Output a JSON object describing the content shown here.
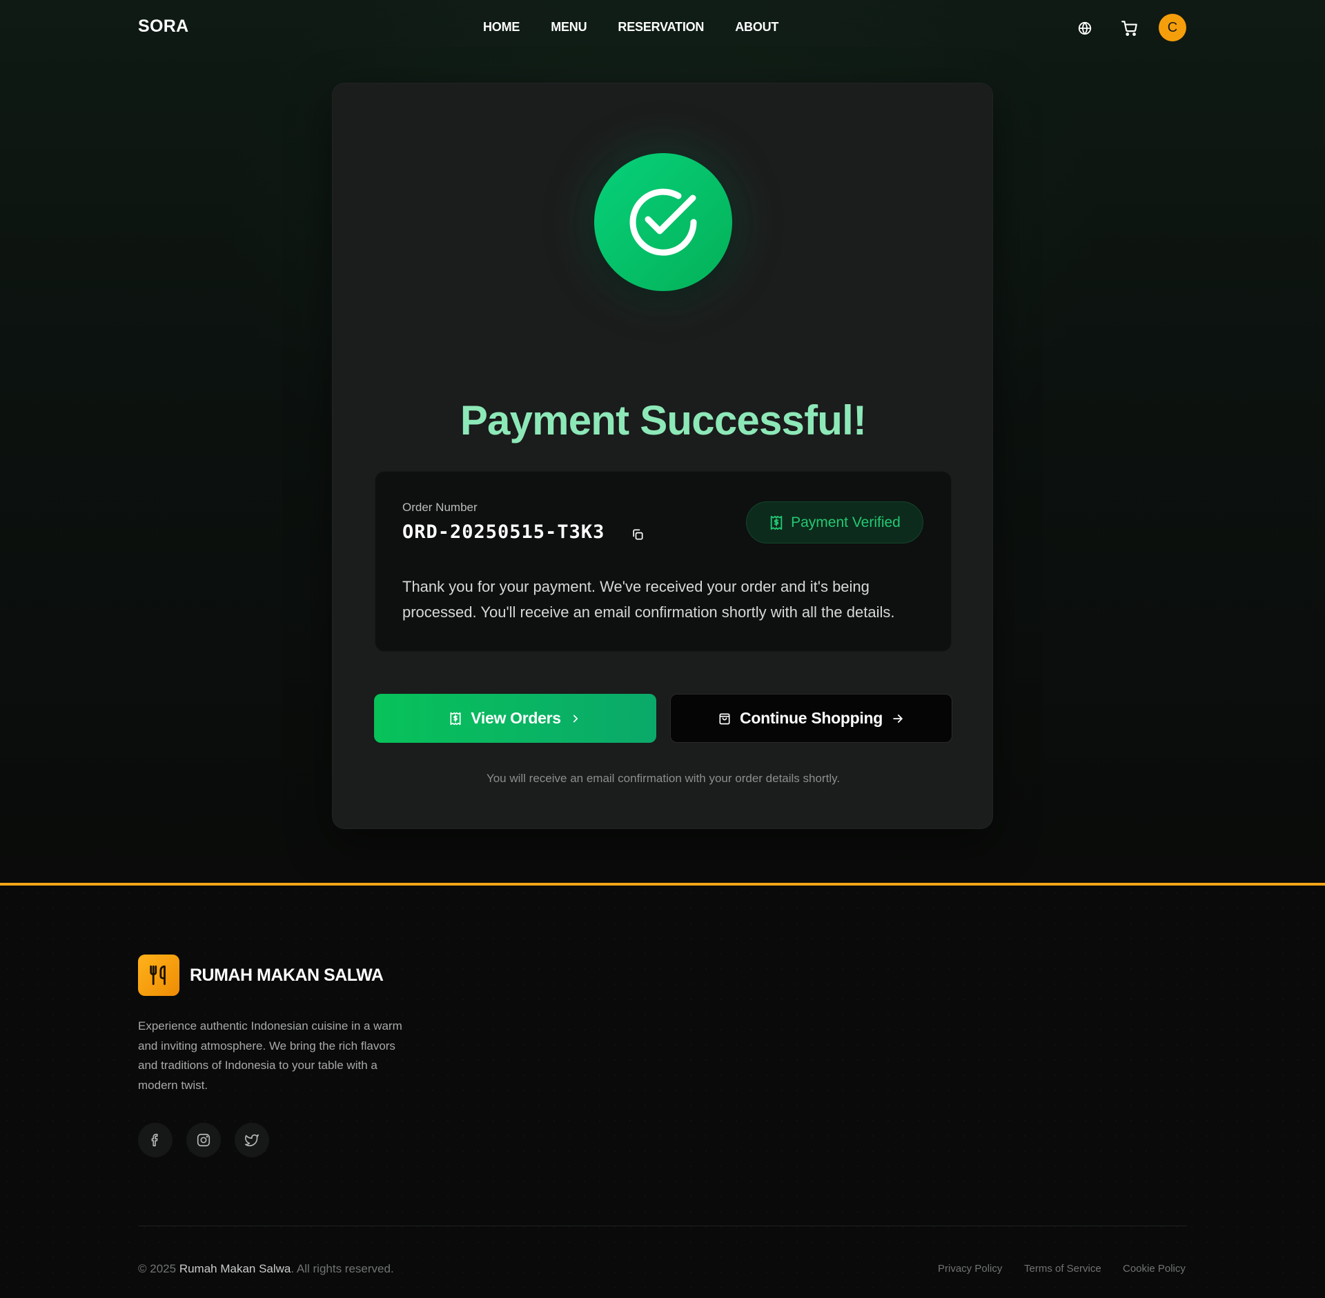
{
  "nav": {
    "brand": "SORA",
    "links": [
      "HOME",
      "MENU",
      "RESERVATION",
      "ABOUT"
    ],
    "avatar_initial": "C",
    "icons": [
      "globe-icon",
      "cart-icon"
    ]
  },
  "card": {
    "title": "Payment Successful!",
    "order_label": "Order Number",
    "order_number": "ORD-20250515-T3K3",
    "badge": "Payment Verified",
    "message": "Thank you for your payment. We've received your order and it's being processed. You'll receive an email confirmation shortly with all the details.",
    "view_orders": "View Orders",
    "continue_shopping": "Continue Shopping",
    "footnote": "You will receive an email confirmation with your order details shortly."
  },
  "footer": {
    "brand": "RUMAH MAKAN SALWA",
    "description": "Experience authentic Indonesian cuisine in a warm and inviting atmosphere. We bring the rich flavors and traditions of Indonesia to your table with a modern twist.",
    "copyright_prefix": "© 2025",
    "copyright_name": "Rumah Makan Salwa",
    "copyright_suffix": ". All rights reserved.",
    "legal": [
      "Privacy Policy",
      "Terms of Service",
      "Cookie Policy"
    ],
    "social": [
      "facebook-icon",
      "instagram-icon",
      "twitter-icon"
    ]
  },
  "colors": {
    "accent_green": "#08c25a",
    "title_green": "#8de8b8",
    "brand_orange": "#f2a516",
    "avatar_orange": "#f59e0b"
  }
}
